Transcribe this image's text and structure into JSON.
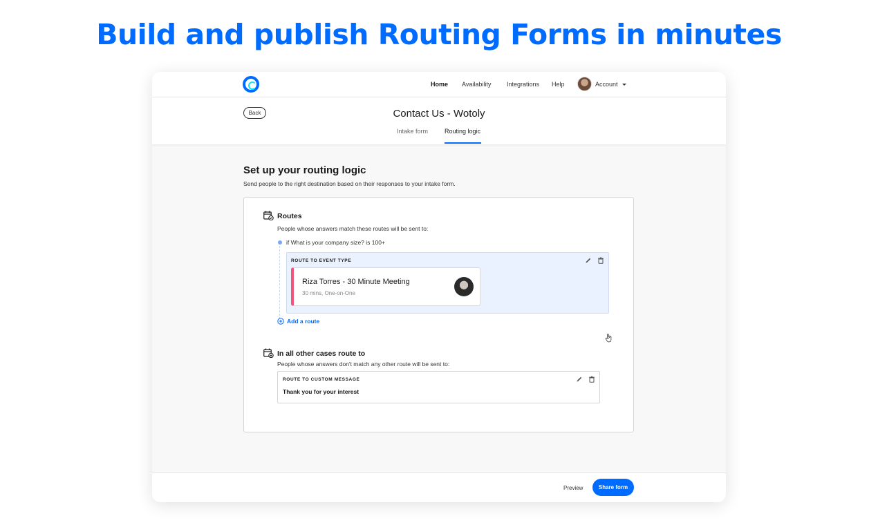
{
  "headline": "Build and publish Routing Forms in minutes",
  "nav": {
    "home": "Home",
    "availability": "Availability",
    "integrations": "Integrations",
    "help": "Help",
    "account": "Account"
  },
  "header": {
    "back": "Back",
    "title": "Contact Us - Wotoly",
    "tabs": [
      "Intake form",
      "Routing logic"
    ],
    "active_tab": "Routing logic"
  },
  "main": {
    "title": "Set up your routing logic",
    "subtitle": "Send people to the right destination based on their responses to your intake form."
  },
  "routes": {
    "heading": "Routes",
    "description": "People whose answers match these routes will be sent to:",
    "condition": "if What is your company size? is 100+",
    "route_label": "ROUTE TO EVENT TYPE",
    "event": {
      "title": "Riza Torres - 30 Minute Meeting",
      "meta": "30 mins, One-on-One"
    },
    "add_route": "Add a route"
  },
  "fallback": {
    "heading": "In all other cases route to",
    "description": "People whose answers don't match any other route will be sent to:",
    "route_label": "ROUTE TO CUSTOM MESSAGE",
    "message": "Thank you for your interest"
  },
  "footer": {
    "preview": "Preview",
    "share": "Share form"
  },
  "colors": {
    "brand": "#006bff",
    "event_accent": "#f0567a",
    "route_bg": "#eaf2ff"
  }
}
